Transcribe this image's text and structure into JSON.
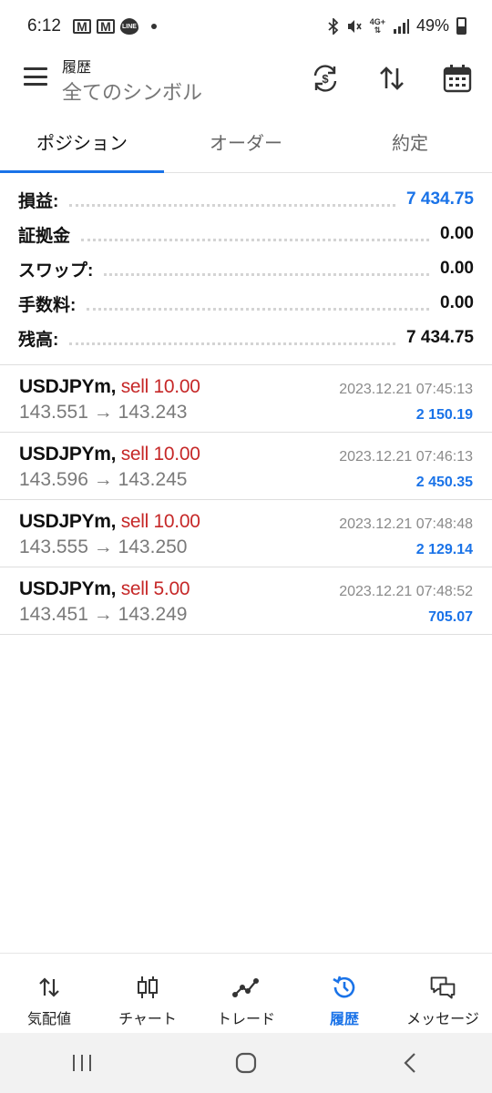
{
  "status_bar": {
    "time": "6:12",
    "battery": "49%",
    "network_label_top": "4G+",
    "icons": [
      "gmail-icon",
      "gmail-icon",
      "line-app-icon",
      "notification-dot-icon",
      "bluetooth-icon",
      "mute-icon",
      "network-icon",
      "signal-icon",
      "battery-icon"
    ],
    "line_badge": "LINE",
    "mail_glyph": "M"
  },
  "app_bar": {
    "title": "履歴",
    "subtitle": "全てのシンボル",
    "icons": [
      "menu-icon",
      "currency-exchange-icon",
      "sort-icon",
      "calendar-icon"
    ]
  },
  "tabs": [
    {
      "label": "ポジション",
      "active": true
    },
    {
      "label": "オーダー",
      "active": false
    },
    {
      "label": "約定",
      "active": false
    }
  ],
  "summary": {
    "profit": {
      "label": "損益:",
      "value": "7 434.75"
    },
    "margin": {
      "label": "証拠金",
      "value": "0.00"
    },
    "swap": {
      "label": "スワップ:",
      "value": "0.00"
    },
    "commission": {
      "label": "手数料:",
      "value": "0.00"
    },
    "balance": {
      "label": "残高:",
      "value": "7 434.75"
    }
  },
  "deals": [
    {
      "symbol": "USDJPYm,",
      "side": "sell 10.00",
      "prices": "143.551 → 143.243",
      "time": "2023.12.21 07:45:13",
      "profit": "2 150.19"
    },
    {
      "symbol": "USDJPYm,",
      "side": "sell 10.00",
      "prices": "143.596 → 143.245",
      "time": "2023.12.21 07:46:13",
      "profit": "2 450.35"
    },
    {
      "symbol": "USDJPYm,",
      "side": "sell 10.00",
      "prices": "143.555 → 143.250",
      "time": "2023.12.21 07:48:48",
      "profit": "2 129.14"
    },
    {
      "symbol": "USDJPYm,",
      "side": "sell 5.00",
      "prices": "143.451 → 143.249",
      "time": "2023.12.21 07:48:52",
      "profit": "705.07"
    }
  ],
  "bottom_nav": [
    {
      "label": "気配値",
      "icon": "quotes-icon",
      "active": false
    },
    {
      "label": "チャート",
      "icon": "chart-icon",
      "active": false
    },
    {
      "label": "トレード",
      "icon": "trade-icon",
      "active": false
    },
    {
      "label": "履歴",
      "icon": "history-icon",
      "active": true
    },
    {
      "label": "メッセージ",
      "icon": "messages-icon",
      "active": false
    }
  ],
  "colors": {
    "accent": "#1a73e8",
    "sell": "#c62828",
    "muted_text": "#7a7a7a"
  }
}
